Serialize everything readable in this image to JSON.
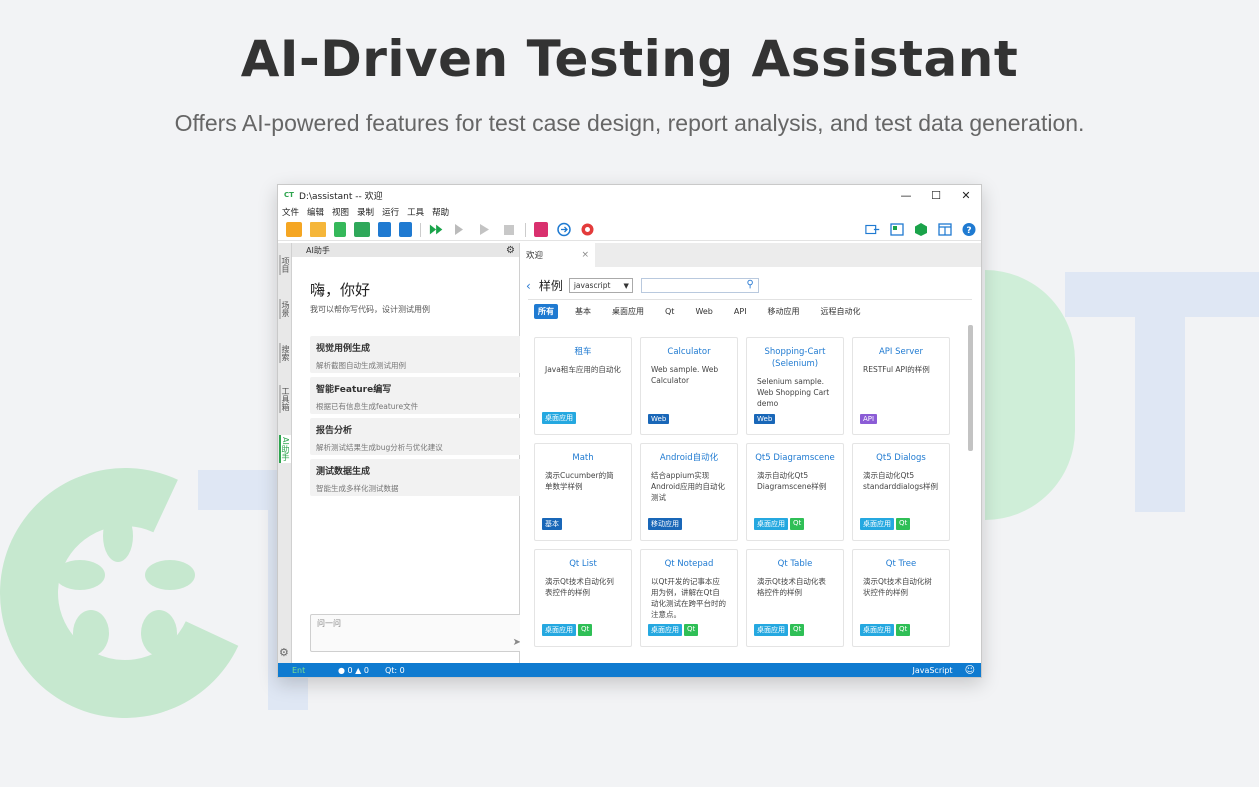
{
  "hero": {
    "title": "AI-Driven Testing Assistant",
    "subtitle": "Offers AI-powered features for test case design, report analysis, and test data generation."
  },
  "window": {
    "logo": "CT",
    "title": "D:\\assistant -- 欢迎",
    "controls": {
      "minimize": "—",
      "maximize": "☐",
      "close": "✕"
    }
  },
  "menu": [
    "文件",
    "编辑",
    "视图",
    "录制",
    "运行",
    "工具",
    "帮助"
  ],
  "toolbar_icons": [
    "new-icon",
    "open-folder-icon",
    "new-file-icon",
    "open-project-icon",
    "save-icon",
    "save-all-icon",
    "run-all-icon",
    "step-icon",
    "run-icon",
    "stop-icon",
    "terminal-icon",
    "navigate-icon",
    "record-icon",
    "export-icon",
    "layout-icon",
    "package-icon",
    "window-icon",
    "help-icon"
  ],
  "colors": {
    "accent": "#1f7ad1",
    "green": "#2da44e",
    "orange": "#f5a623",
    "status": "#0f7bd0"
  },
  "side_tabs": [
    "项目",
    "场景",
    "搜索",
    "工具箱",
    "AI助手"
  ],
  "ai_panel": {
    "header": "AI助手",
    "greeting": "嗨，你好",
    "description": "我可以帮你写代码，设计测试用例",
    "cards": [
      {
        "title": "视觉用例生成",
        "desc": "解析截图自动生成测试用例"
      },
      {
        "title": "智能Feature编写",
        "desc": "根据已有信息生成feature文件"
      },
      {
        "title": "报告分析",
        "desc": "解析测试结果生成bug分析与优化建议"
      },
      {
        "title": "测试数据生成",
        "desc": "智能生成多样化测试数据"
      }
    ],
    "input_placeholder": "问一问"
  },
  "tab": {
    "label": "欢迎",
    "close": "×"
  },
  "samples": {
    "title": "样例",
    "language": "javascript",
    "filters": [
      "所有",
      "基本",
      "桌面应用",
      "Qt",
      "Web",
      "API",
      "移动应用",
      "远程自动化"
    ],
    "cards": [
      {
        "title": "租车",
        "desc": "Java租车应用的自动化",
        "tags": [
          {
            "text": "桌面应用",
            "color": "#25a8e0"
          }
        ]
      },
      {
        "title": "Calculator",
        "desc": "Web sample. Web Calculator",
        "tags": [
          {
            "text": "Web",
            "color": "#1967b8"
          }
        ]
      },
      {
        "title": "Shopping-Cart (Selenium)",
        "desc": "Selenium sample. Web Shopping Cart demo",
        "tags": [
          {
            "text": "Web",
            "color": "#1967b8"
          }
        ]
      },
      {
        "title": "API Server",
        "desc": "RESTFul API的样例",
        "tags": [
          {
            "text": "API",
            "color": "#8b5cd6"
          }
        ]
      },
      {
        "title": "Math",
        "desc": "演示Cucumber的简单数学样例",
        "tags": [
          {
            "text": "基本",
            "color": "#1967b8"
          }
        ]
      },
      {
        "title": "Android自动化",
        "desc": "结合appium实现Android应用的自动化测试",
        "tags": [
          {
            "text": "移动应用",
            "color": "#1967b8"
          }
        ]
      },
      {
        "title": "Qt5 Diagramscene",
        "desc": "演示自动化Qt5 Diagramscene样例",
        "tags": [
          {
            "text": "桌面应用",
            "color": "#25a8e0"
          },
          {
            "text": "Qt",
            "color": "#2fbf56"
          }
        ]
      },
      {
        "title": "Qt5 Dialogs",
        "desc": "演示自动化Qt5 standarddialogs样例",
        "tags": [
          {
            "text": "桌面应用",
            "color": "#25a8e0"
          },
          {
            "text": "Qt",
            "color": "#2fbf56"
          }
        ]
      },
      {
        "title": "Qt List",
        "desc": "演示Qt技术自动化列表控件的样例",
        "tags": [
          {
            "text": "桌面应用",
            "color": "#25a8e0"
          },
          {
            "text": "Qt",
            "color": "#2fbf56"
          }
        ]
      },
      {
        "title": "Qt Notepad",
        "desc": "以Qt开发的记事本应用为例，讲解在Qt自动化测试在跨平台时的注意点。",
        "tags": [
          {
            "text": "桌面应用",
            "color": "#25a8e0"
          },
          {
            "text": "Qt",
            "color": "#2fbf56"
          }
        ]
      },
      {
        "title": "Qt Table",
        "desc": "演示Qt技术自动化表格控件的样例",
        "tags": [
          {
            "text": "桌面应用",
            "color": "#25a8e0"
          },
          {
            "text": "Qt",
            "color": "#2fbf56"
          }
        ]
      },
      {
        "title": "Qt Tree",
        "desc": "演示Qt技术自动化树状控件的样例",
        "tags": [
          {
            "text": "桌面应用",
            "color": "#25a8e0"
          },
          {
            "text": "Qt",
            "color": "#2fbf56"
          }
        ]
      }
    ]
  },
  "status": {
    "ent": "Ent",
    "errors": "0",
    "warnings": "0",
    "qt": "Qt: 0",
    "language": "JavaScript"
  }
}
